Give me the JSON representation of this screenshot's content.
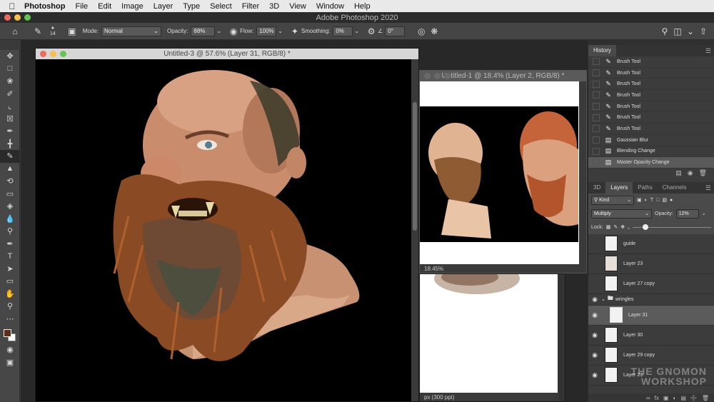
{
  "menubar": {
    "app_name": "Photoshop",
    "items": [
      "File",
      "Edit",
      "Image",
      "Layer",
      "Type",
      "Select",
      "Filter",
      "3D",
      "View",
      "Window",
      "Help"
    ]
  },
  "window": {
    "title": "Adobe Photoshop 2020"
  },
  "options": {
    "brush_size": "14",
    "mode_label": "Mode:",
    "mode_value": "Normal",
    "opacity_label": "Opacity:",
    "opacity_value": "88%",
    "flow_label": "Flow:",
    "flow_value": "100%",
    "smoothing_label": "Smoothing:",
    "smoothing_value": "0%",
    "angle_value": "0°"
  },
  "documents": {
    "doc1_title": "Untitled-3 @ 57.6% (Layer 31, RGB/8) *",
    "doc2_title": "Untitled-1 @ 18.4% (Layer 2, RGB/8) *",
    "doc2_zoom": "18.45%",
    "doc3_status": "px (300 ppi)"
  },
  "history": {
    "tab": "History",
    "items": [
      {
        "label": "Brush Tool",
        "icon": "brush-icon"
      },
      {
        "label": "Brush Tool",
        "icon": "brush-icon"
      },
      {
        "label": "Brush Tool",
        "icon": "brush-icon"
      },
      {
        "label": "Brush Tool",
        "icon": "brush-icon"
      },
      {
        "label": "Brush Tool",
        "icon": "brush-icon"
      },
      {
        "label": "Brush Tool",
        "icon": "brush-icon"
      },
      {
        "label": "Brush Tool",
        "icon": "brush-icon"
      },
      {
        "label": "Gaussian Blur",
        "icon": "document-icon"
      },
      {
        "label": "Blending Change",
        "icon": "document-icon"
      },
      {
        "label": "Master Opacity Change",
        "icon": "document-icon"
      }
    ]
  },
  "layers_panel": {
    "tabs": [
      "3D",
      "Layers",
      "Paths",
      "Channels"
    ],
    "kind_label": "Kind",
    "blend_mode": "Multiply",
    "opacity_label": "Opacity:",
    "opacity_value": "12%",
    "lock_label": "Lock:",
    "layers": [
      "guide",
      "Layer 23",
      "Layer 27 copy",
      "wringles",
      "Layer 31",
      "Layer 30",
      "Layer 29 copy",
      "Layer 29"
    ]
  },
  "watermark": {
    "line1": "THE GNOMON",
    "line2": "WORKSHOP"
  },
  "colors": {
    "foreground": "#5a2f1c",
    "background": "#ffffff",
    "accent": "#5b5b5b"
  }
}
